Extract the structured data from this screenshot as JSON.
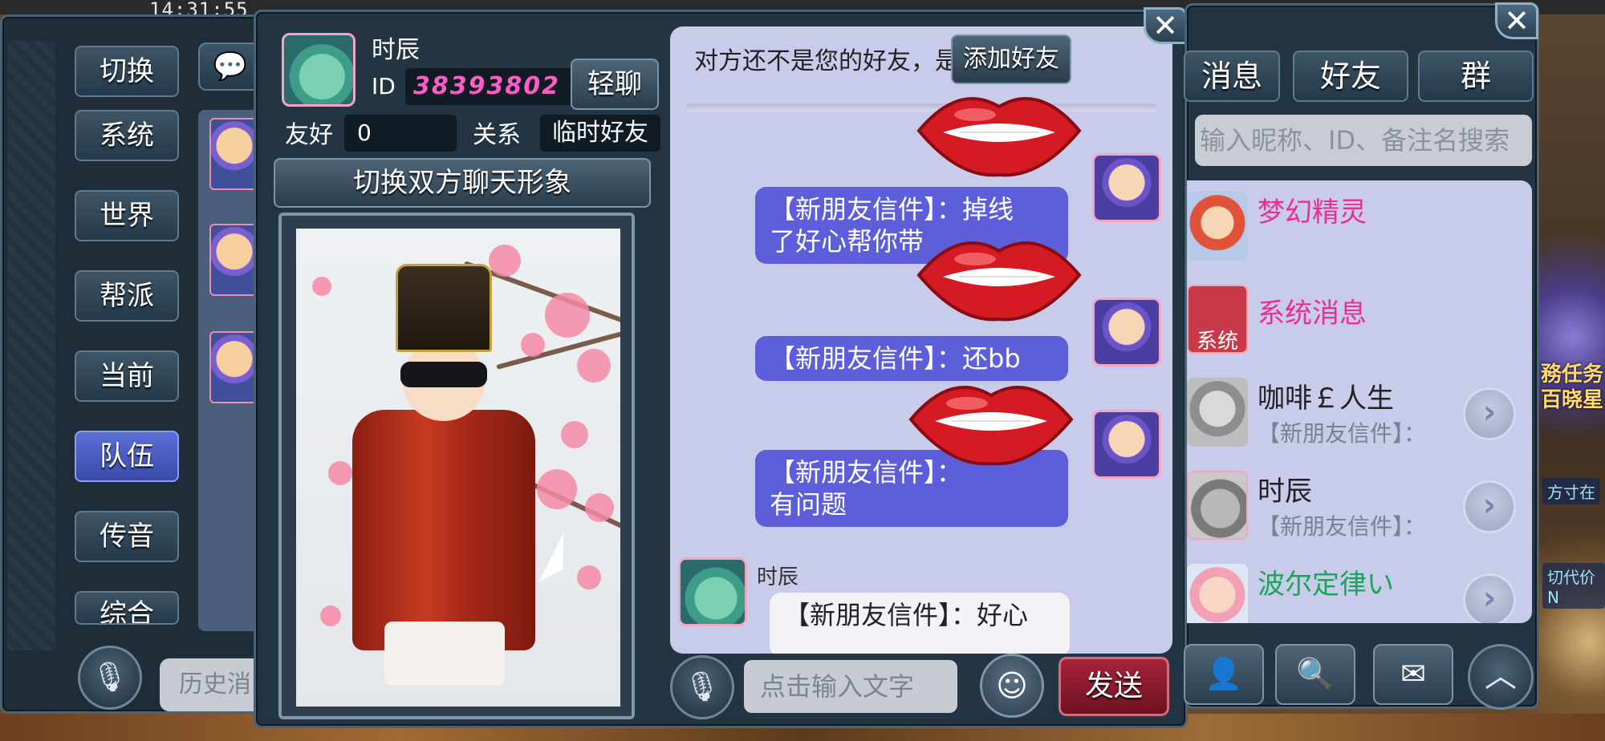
{
  "status_bar": {
    "clock": "14:31:55"
  },
  "scene": {
    "right_text_1": "務任务",
    "right_text_2": "百晓星",
    "tag_1": "方寸在",
    "tag_2": "切代价N"
  },
  "left_panel": {
    "switch_label": "切换",
    "channels": [
      "系统",
      "世界",
      "帮派",
      "当前",
      "队伍",
      "传音",
      "综合"
    ],
    "active_channel": "队伍",
    "history_placeholder": "历史消"
  },
  "profile": {
    "name": "时辰",
    "id_label": "ID",
    "id_value": "38393802",
    "quick_chat_label": "轻聊",
    "friendliness_label": "友好",
    "friendliness_value": "0",
    "relation_label": "关系",
    "relation_value": "临时好友",
    "switch_image_label": "切换双方聊天形象"
  },
  "chat": {
    "not_friend_notice": "对方还不是您的好友，是否",
    "add_friend_label": "添加好友",
    "messages": [
      {
        "text_line1": "【新朋友信件】：掉线",
        "text_line2": "了好心帮你带"
      },
      {
        "text_line1": "【新朋友信件】：还bb"
      },
      {
        "text_line1": "【新朋友信件】：",
        "text_line2": "有问题"
      }
    ],
    "incoming": {
      "sender": "时辰",
      "text": "【新朋友信件】：好心"
    },
    "input_placeholder": "点击输入文字",
    "send_label": "发送"
  },
  "friends_panel": {
    "tabs": [
      "消息",
      "好友",
      "群"
    ],
    "search_placeholder": "输入昵称、ID、备注名搜索",
    "items": [
      {
        "name": "梦幻精灵",
        "sub": "",
        "color": "#e8308c"
      },
      {
        "name": "系统消息",
        "sub": "",
        "color": "#e8308c",
        "badge": "系统"
      },
      {
        "name": "咖啡￡人生",
        "sub": "【新朋友信件】：",
        "color": "#222222"
      },
      {
        "name": "时辰",
        "sub": "【新朋友信件】：",
        "color": "#222222"
      },
      {
        "name": "波尔定律い",
        "sub": "",
        "color": "#1aa65a"
      }
    ]
  },
  "colors": {
    "accent_blue": "#5c5fd9",
    "send_red": "#a6243a",
    "panel_dark": "#233443",
    "chat_bg": "#c9cbea"
  }
}
